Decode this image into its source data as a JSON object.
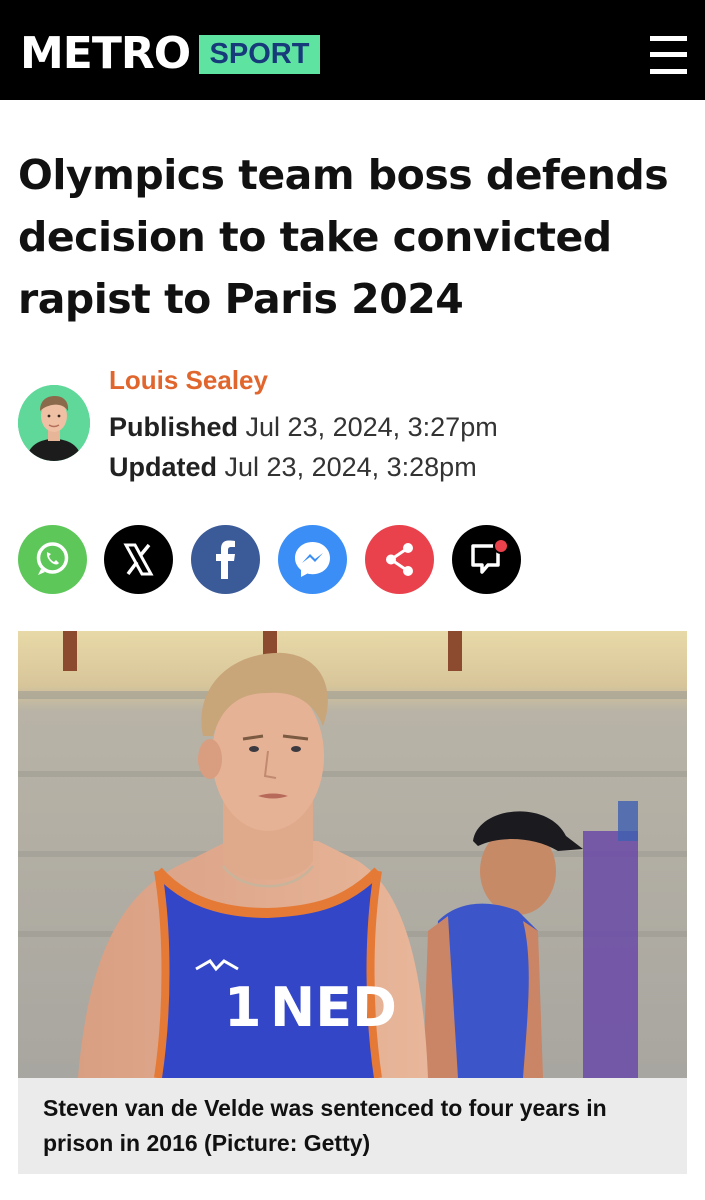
{
  "header": {
    "logo": "METRO",
    "section": "SPORT",
    "menu_icon": "hamburger-menu-icon",
    "colors": {
      "bar": "#000000",
      "section_badge_bg": "#5fe3a1",
      "section_badge_text": "#163a7a"
    }
  },
  "article": {
    "headline_lines": [
      "Olympics team boss defends",
      "decision to take convicted",
      "rapist to Paris 2024"
    ],
    "author": "Louis Sealey",
    "published_label": "Published",
    "published_date": "Jul 23, 2024, 3:27pm",
    "updated_label": "Updated",
    "updated_date": "Jul 23, 2024, 3:28pm",
    "author_color": "#e0662d"
  },
  "share_buttons": [
    {
      "icon": "whatsapp-icon",
      "color": "#5ec75a"
    },
    {
      "icon": "x-icon",
      "color": "#000000"
    },
    {
      "icon": "facebook-icon",
      "color": "#3b5a98"
    },
    {
      "icon": "messenger-icon",
      "color": "#3a8ef5"
    },
    {
      "icon": "share-icon",
      "color": "#e9424d"
    },
    {
      "icon": "comments-icon",
      "color": "#000000"
    }
  ],
  "hero": {
    "jersey_number": "1",
    "jersey_country": "NED"
  },
  "caption": "Steven van de Velde was sentenced to four years in prison in 2016 (Picture: Getty)"
}
